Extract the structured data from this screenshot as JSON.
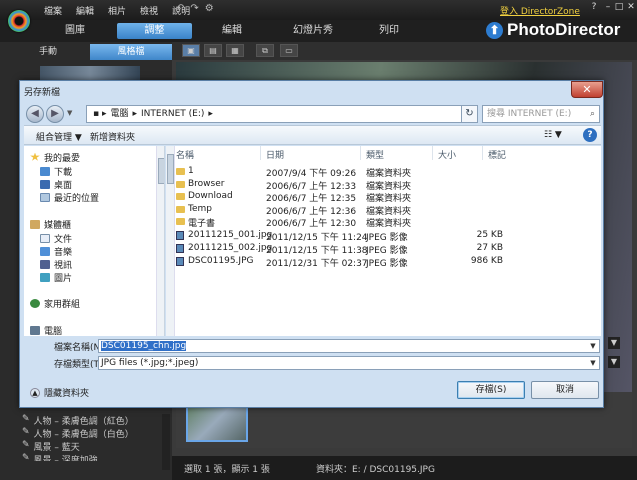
{
  "app": {
    "menu": [
      "檔案",
      "編輯",
      "相片",
      "檢視",
      "說明"
    ],
    "director_zone_link": "登入 DirectorZone",
    "window_controls": {
      "help": "?",
      "minimize": "–",
      "maximize": "□",
      "close": "✕"
    },
    "brand": "PhotoDirector",
    "modes": [
      {
        "label": "圖庫",
        "active": false
      },
      {
        "label": "調整",
        "active": true
      },
      {
        "label": "編輯",
        "active": false
      },
      {
        "label": "幻燈片秀",
        "active": false
      },
      {
        "label": "列印",
        "active": false
      }
    ],
    "left_tabs": [
      {
        "label": "手動",
        "active": false
      },
      {
        "label": "風格檔",
        "active": true
      }
    ],
    "presets": [
      "人物 – 柔膚色調（紅色）",
      "人物 – 柔膚色調（白色）",
      "風景 – 藍天",
      "風景 – 深度加強"
    ],
    "status": {
      "selection": "選取 1 張，顯示 1 張",
      "path": "資料夾：E: / DSC01195.JPG"
    }
  },
  "dialog": {
    "title": "另存新檔",
    "close": "✕",
    "breadcrumb": [
      "電腦",
      "INTERNET (E:)"
    ],
    "search_placeholder": "搜尋 INTERNET (E:)",
    "toolbar": {
      "organize": "組合管理 ▼",
      "new_folder": "新增資料夾",
      "view": "☷ ▼",
      "help": "?"
    },
    "nav": {
      "favorites": "我的最愛",
      "favorites_items": [
        "下載",
        "桌面",
        "最近的位置"
      ],
      "libraries": "媒體櫃",
      "library_items": [
        "文件",
        "音樂",
        "視訊",
        "圖片"
      ],
      "homegroup": "家用群組",
      "computer": "電腦"
    },
    "columns": {
      "name": "名稱",
      "date": "日期",
      "type": "類型",
      "size": "大小",
      "tags": "標記"
    },
    "files": [
      {
        "name": "1",
        "date": "2007/9/4 下午 09:26",
        "type": "檔案資料夾",
        "size": "",
        "kind": "folder"
      },
      {
        "name": "Browser",
        "date": "2006/6/7 上午 12:33",
        "type": "檔案資料夾",
        "size": "",
        "kind": "folder"
      },
      {
        "name": "Download",
        "date": "2006/6/7 上午 12:35",
        "type": "檔案資料夾",
        "size": "",
        "kind": "folder"
      },
      {
        "name": "Temp",
        "date": "2006/6/7 上午 12:36",
        "type": "檔案資料夾",
        "size": "",
        "kind": "folder"
      },
      {
        "name": "電子書",
        "date": "2006/6/7 上午 12:30",
        "type": "檔案資料夾",
        "size": "",
        "kind": "folder"
      },
      {
        "name": "20111215_001.jpg",
        "date": "2011/12/15 下午 11:24",
        "type": "JPEG 影像",
        "size": "25 KB",
        "kind": "jpg"
      },
      {
        "name": "20111215_002.jpg",
        "date": "2011/12/15 下午 11:38",
        "type": "JPEG 影像",
        "size": "27 KB",
        "kind": "jpg"
      },
      {
        "name": "DSC01195.JPG",
        "date": "2011/12/31 下午 02:37",
        "type": "JPEG 影像",
        "size": "986 KB",
        "kind": "jpg"
      }
    ],
    "filename_label": "檔案名稱(N):",
    "filename_value": "DSC01195_chn.jpg",
    "filetype_label": "存檔類型(T):",
    "filetype_value": "JPG files (*.jpg;*.jpeg)",
    "hide_folders": "隱藏資料夾",
    "save_button": "存檔(S)",
    "cancel_button": "取消"
  }
}
